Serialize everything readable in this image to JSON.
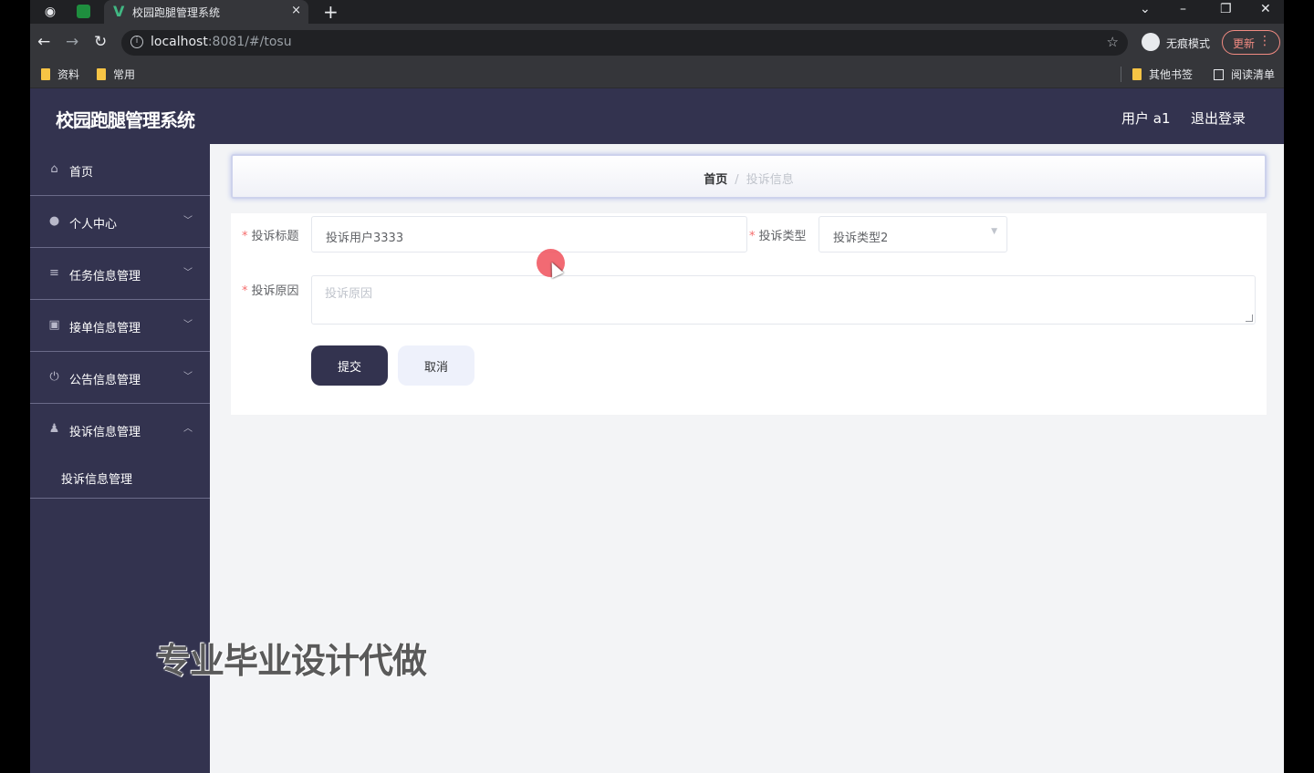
{
  "browser": {
    "tab_title": "校园跑腿管理系统",
    "tab_close": "×",
    "new_tab": "+",
    "url_host": "localhost",
    "url_rest": ":8081/#/tosu",
    "incognito_label": "无痕模式",
    "update_label": "更新",
    "bookmarks": [
      "资料",
      "常用"
    ],
    "other_bookmarks": "其他书签",
    "reading_list": "阅读清单"
  },
  "header": {
    "title": "校园跑腿管理系统",
    "user": "用户 a1",
    "logout": "退出登录"
  },
  "sidebar": {
    "items": [
      {
        "label": "首页",
        "icon": "home-icon"
      },
      {
        "label": "个人中心",
        "icon": "user-icon"
      },
      {
        "label": "任务信息管理",
        "icon": "sliders-icon"
      },
      {
        "label": "接单信息管理",
        "icon": "clipboard-icon"
      },
      {
        "label": "公告信息管理",
        "icon": "power-icon"
      },
      {
        "label": "投诉信息管理",
        "icon": "person-icon"
      }
    ],
    "submenu_label": "投诉信息管理"
  },
  "breadcrumb": {
    "home": "首页",
    "separator": "/",
    "current": "投诉信息"
  },
  "form": {
    "title_label": "投诉标题",
    "title_value": "投诉用户3333",
    "type_label": "投诉类型",
    "type_value": "投诉类型2",
    "reason_label": "投诉原因",
    "reason_placeholder": "投诉原因",
    "submit": "提交",
    "cancel": "取消"
  },
  "watermark": "专业毕业设计代做",
  "colors": {
    "sidebar": "#33334f",
    "submit_button": "#33334f",
    "required_mark": "#f56c6c"
  }
}
